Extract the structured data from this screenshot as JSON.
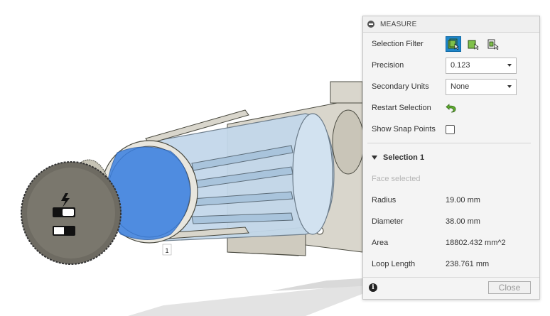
{
  "dialog": {
    "title": "MEASURE",
    "selection_filter_label": "Selection Filter",
    "precision_label": "Precision",
    "precision_value": "0.123",
    "secondary_units_label": "Secondary Units",
    "secondary_units_value": "None",
    "restart_selection_label": "Restart Selection",
    "show_snap_points_label": "Show Snap Points",
    "show_snap_points_checked": false,
    "section_title": "Selection 1",
    "selection_status": "Face selected",
    "measurements": [
      {
        "label": "Radius",
        "value": "19.00 mm"
      },
      {
        "label": "Diameter",
        "value": "38.00 mm"
      },
      {
        "label": "Area",
        "value": "18802.432 mm^2"
      },
      {
        "label": "Loop Length",
        "value": "238.761 mm"
      }
    ],
    "close_label": "Close",
    "info_glyph": "i"
  },
  "viewport": {
    "selection_marker": "1",
    "selection_color": "#3a7fe0",
    "body_color": "#d9d6cc",
    "transparent_color": "#b8d4ee"
  }
}
